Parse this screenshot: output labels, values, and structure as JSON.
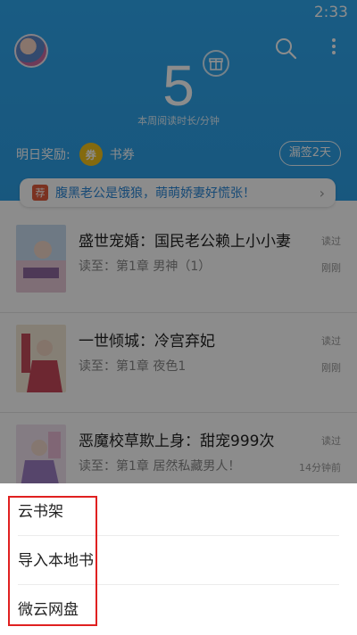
{
  "status_bar": {
    "time": "2:33"
  },
  "header": {
    "read_minutes": "5",
    "read_caption": "本周阅读时长/分钟",
    "reward_label": "明日奖励:",
    "coin_glyph": "券",
    "reward_item": "书券",
    "signin_label": "漏签2天"
  },
  "banner": {
    "tag": "荐",
    "text": "腹黑老公是饿狼，萌萌娇妻好慌张！",
    "arrow": "›"
  },
  "books": [
    {
      "title": "盛世宠婚：国民老公赖上小小妻",
      "progress": "读至：第1章 男神（1）",
      "status": "读过",
      "time": "刚刚"
    },
    {
      "title": "一世倾城：冷宫弃妃",
      "progress": "读至：第1章 夜色1",
      "status": "读过",
      "time": "刚刚"
    },
    {
      "title": "恶魔校草欺上身：甜宠999次",
      "progress": "读至：第1章 居然私藏男人！",
      "status": "读过",
      "time": "14分钟前"
    }
  ],
  "menu": {
    "items": [
      "云书架",
      "导入本地书",
      "微云网盘"
    ]
  },
  "colors": {
    "header_blue": "#2fa8ef",
    "highlight_red": "#e02020",
    "coin_yellow": "#f1c21b",
    "banner_text": "#2a87d8"
  }
}
